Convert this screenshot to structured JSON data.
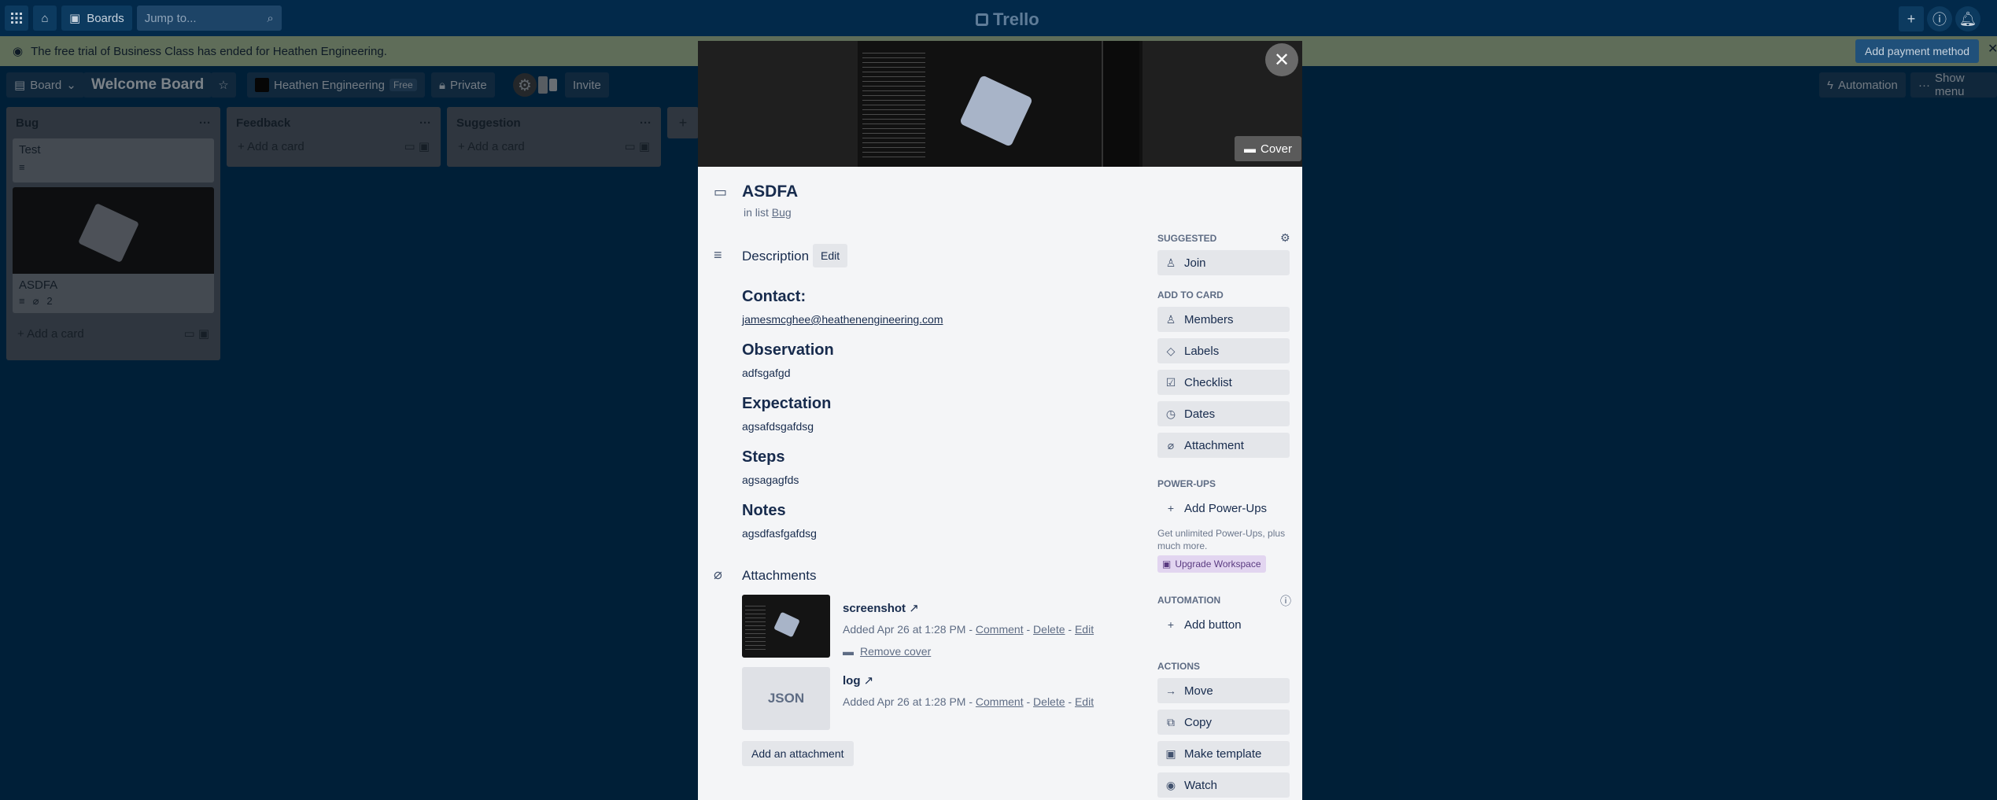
{
  "topnav": {
    "boards_label": "Boards",
    "jump_placeholder": "Jump to...",
    "logo": "Trello"
  },
  "banner": {
    "message": "The free trial of Business Class has ended for Heathen Engineering.",
    "pay_button": "Add payment method"
  },
  "board_header": {
    "view_label": "Board",
    "title": "Welcome Board",
    "workspace": "Heathen Engineering",
    "plan_badge": "Free",
    "visibility": "Private",
    "invite": "Invite",
    "automation": "Automation",
    "show_menu": "Show menu"
  },
  "lists": [
    {
      "title": "Bug",
      "cards": [
        {
          "title": "Test"
        },
        {
          "title": "ASDFA",
          "attachments": "2"
        }
      ],
      "add_card": "Add a card"
    },
    {
      "title": "Feedback",
      "add_card": "Add a card"
    },
    {
      "title": "Suggestion",
      "add_card": "Add a card"
    }
  ],
  "modal": {
    "cover_button": "Cover",
    "card_title": "ASDFA",
    "in_list_prefix": "in list",
    "list_name": "Bug",
    "description_label": "Description",
    "edit_label": "Edit",
    "description": {
      "contact_heading": "Contact:",
      "contact_value": "jamesmcghee@heathenengineering.com",
      "observation_heading": "Observation",
      "observation_value": "adfsgafgd",
      "expectation_heading": "Expectation",
      "expectation_value": "agsafdsgafdsg",
      "steps_heading": "Steps",
      "steps_value": "agsagagfds",
      "notes_heading": "Notes",
      "notes_value": "agsdfasfgafdsg"
    },
    "attachments_label": "Attachments",
    "attachments": [
      {
        "name": "screenshot",
        "added": "Added Apr 26 at 1:28 PM",
        "comment": "Comment",
        "delete": "Delete",
        "edit": "Edit",
        "remove_cover": "Remove cover"
      },
      {
        "name": "log",
        "thumb_text": "JSON",
        "added": "Added Apr 26 at 1:28 PM",
        "comment": "Comment",
        "delete": "Delete",
        "edit": "Edit"
      }
    ],
    "add_attachment": "Add an attachment",
    "sidebar": {
      "suggested_label": "Suggested",
      "join": "Join",
      "add_to_card_label": "Add to card",
      "members": "Members",
      "labels": "Labels",
      "checklist": "Checklist",
      "dates": "Dates",
      "attachment": "Attachment",
      "powerups_label": "Power-Ups",
      "add_powerups": "Add Power-Ups",
      "powerups_note": "Get unlimited Power-Ups, plus much more.",
      "upgrade": "Upgrade Workspace",
      "automation_label": "Automation",
      "add_button": "Add button",
      "actions_label": "Actions",
      "move": "Move",
      "copy": "Copy",
      "make_template": "Make template",
      "watch": "Watch"
    }
  }
}
